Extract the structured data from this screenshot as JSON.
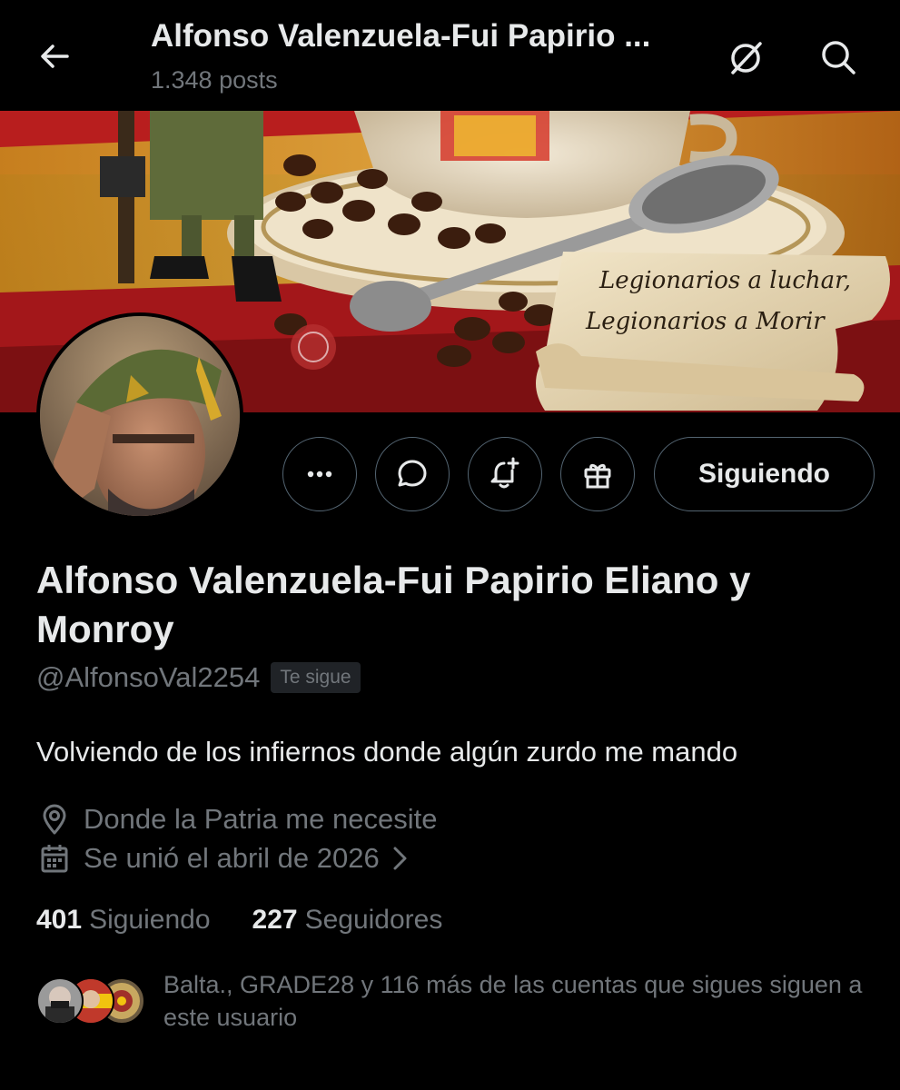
{
  "header": {
    "title": "Alfonso Valenzuela-Fui Papirio ...",
    "post_count": "1.348 posts"
  },
  "banner": {
    "scroll_text_line1": "Legionarios a luchar,",
    "scroll_text_line2": "Legionarios a Morir"
  },
  "actions": {
    "follow_label": "Siguiendo"
  },
  "profile": {
    "display_name": "Alfonso Valenzuela-Fui Papirio Eliano y Monroy",
    "handle": "@AlfonsoVal2254",
    "follows_you_badge": "Te sigue",
    "bio": "Volviendo de los infiernos donde algún zurdo me mando",
    "location": "Donde la Patria me necesite",
    "joined": "Se unió el abril de 2026"
  },
  "stats": {
    "following_count": "401",
    "following_label": "Siguiendo",
    "followers_count": "227",
    "followers_label": "Seguidores"
  },
  "followed_by": {
    "text": "Balta., GRADE28 y 116 más de las cuentas que sigues siguen a este usuario"
  },
  "colors": {
    "background": "#000000",
    "primary_text": "#e7e9ea",
    "secondary_text": "#71767b",
    "border": "#536471"
  },
  "icons": [
    "back-arrow-icon",
    "grok-icon",
    "search-icon",
    "more-icon",
    "message-icon",
    "notification-add-icon",
    "gift-icon",
    "location-icon",
    "calendar-icon",
    "chevron-right-icon"
  ]
}
